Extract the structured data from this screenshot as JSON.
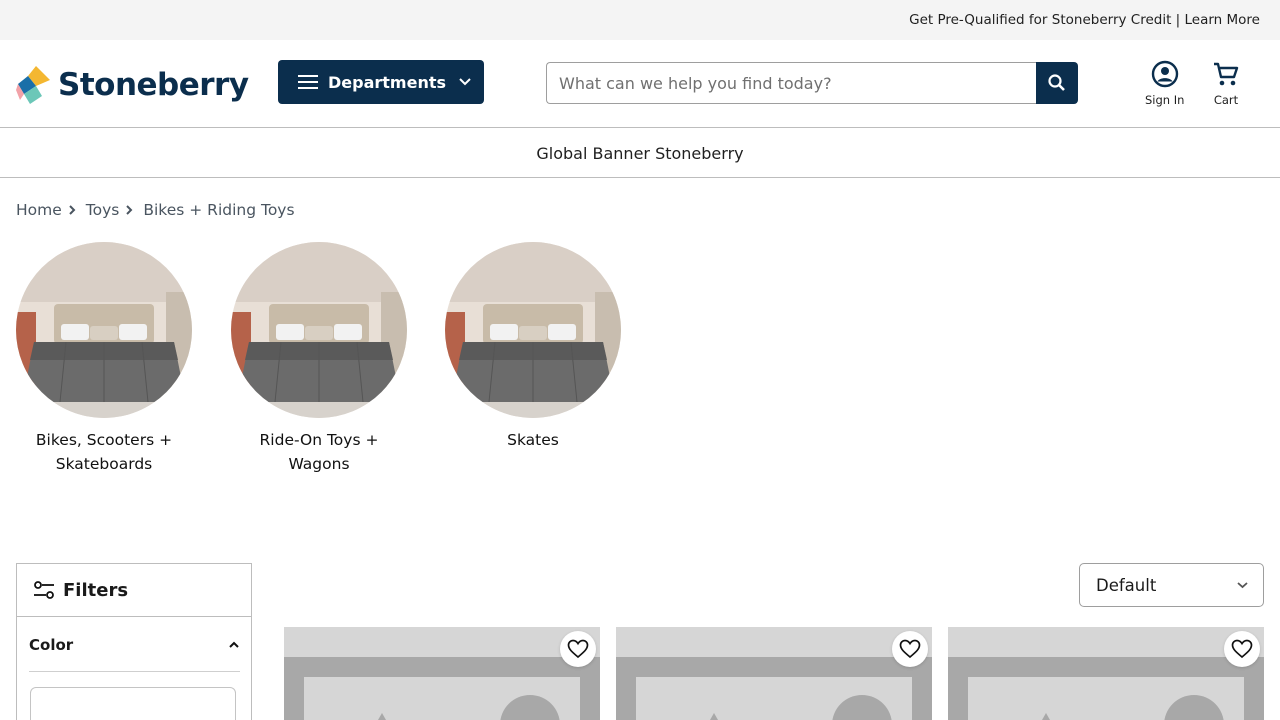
{
  "top_bar": {
    "promo_text": "Get Pre-Qualified for Stoneberry Credit | Learn More"
  },
  "header": {
    "logo_text": "Stoneberry",
    "departments_label": "Departments",
    "search": {
      "placeholder": "What can we help you find today?",
      "value": ""
    },
    "sign_in_label": "Sign In",
    "cart_label": "Cart"
  },
  "banner": {
    "text": "Global Banner Stoneberry"
  },
  "breadcrumb": {
    "items": [
      "Home",
      "Toys",
      "Bikes + Riding Toys"
    ]
  },
  "categories": [
    {
      "name": "Bikes, Scooters + Skateboards"
    },
    {
      "name": "Ride-On Toys + Wagons"
    },
    {
      "name": "Skates"
    }
  ],
  "filters": {
    "title": "Filters",
    "color_label": "Color"
  },
  "sort": {
    "selected": "Default"
  },
  "colors": {
    "brand_navy": "#0b2e4d",
    "placeholder_gray": "#d6d6d6",
    "placeholder_dark": "#a8a8a8"
  },
  "icons": [
    "menu-icon",
    "chevron-down-icon",
    "search-icon",
    "account-icon",
    "cart-icon",
    "chevron-right-icon",
    "filter-sliders-icon",
    "chevron-up-icon",
    "heart-icon"
  ]
}
